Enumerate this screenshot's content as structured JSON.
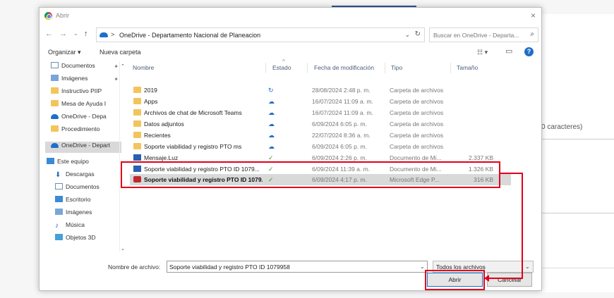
{
  "background": {
    "snippet_text": "0 caracteres)"
  },
  "dialog": {
    "title": "Abrir",
    "close_glyph": "×"
  },
  "address": {
    "back": "←",
    "forward": "→",
    "recent": "⌄",
    "up": "↑",
    "separator": ">",
    "path": "OneDrive - Departamento Nacional de Planeacion",
    "dropdown": "⌄",
    "refresh": "↻",
    "search_placeholder": "Buscar en OneDrive - Departa...",
    "search_icon": "⌕"
  },
  "toolbar": {
    "organize": "Organizar ▾",
    "new_folder": "Nueva carpeta",
    "view_icon": "☷ ▾",
    "pane_icon": "▭",
    "help": "?"
  },
  "sidebar": {
    "items": [
      {
        "label": "Documentos",
        "icon": "doc",
        "pinned": true
      },
      {
        "label": "Imágenes",
        "icon": "img",
        "pinned": true
      },
      {
        "label": "Instructivo PIIP",
        "icon": "folder",
        "pinned": false
      },
      {
        "label": "Mesa de Ayuda I",
        "icon": "folder",
        "pinned": false
      },
      {
        "label": "OneDrive - Depa",
        "icon": "cloud",
        "pinned": false
      },
      {
        "label": "Procedimiento",
        "icon": "folder",
        "pinned": false
      },
      {
        "label": "OneDrive - Depart",
        "icon": "cloud",
        "pinned": false,
        "selected": true
      },
      {
        "label": "Este equipo",
        "icon": "pc",
        "pinned": false
      },
      {
        "label": "Descargas",
        "icon": "down",
        "pinned": false
      },
      {
        "label": "Documentos",
        "icon": "doc",
        "pinned": false
      },
      {
        "label": "Escritorio",
        "icon": "pc",
        "pinned": false
      },
      {
        "label": "Imágenes",
        "icon": "img",
        "pinned": false
      },
      {
        "label": "Música",
        "icon": "music",
        "pinned": false
      },
      {
        "label": "Objetos 3D",
        "icon": "3d",
        "pinned": false
      }
    ],
    "pin_glyph": "✦",
    "scroll_up": "⌃",
    "scroll_down": "⌄"
  },
  "columns": {
    "name": "Nombre",
    "state": "Estado",
    "date": "Fecha de modificación",
    "type": "Tipo",
    "size": "Tamaño",
    "sort_arrow": "^"
  },
  "files": [
    {
      "name": "2019",
      "icon": "folder",
      "state": "sync",
      "state_glyph": "↻",
      "date": "28/08/2024 2:48 p. m.",
      "type": "Carpeta de archivos",
      "size": ""
    },
    {
      "name": "Apps",
      "icon": "folder",
      "state": "cloud",
      "state_glyph": "☁",
      "date": "16/07/2024 11:09 a. m.",
      "type": "Carpeta de archivos",
      "size": ""
    },
    {
      "name": "Archivos de chat de Microsoft Teams",
      "icon": "folder",
      "state": "cloud",
      "state_glyph": "☁",
      "date": "16/07/2024 11:09 a. m.",
      "type": "Carpeta de archivos",
      "size": ""
    },
    {
      "name": "Datos adjuntos",
      "icon": "folder",
      "state": "cloud",
      "state_glyph": "☁",
      "date": "6/09/2024 6:05 p. m.",
      "type": "Carpeta de archivos",
      "size": ""
    },
    {
      "name": "Recientes",
      "icon": "folder",
      "state": "cloud",
      "state_glyph": "☁",
      "date": "22/07/2024 8:36 a. m.",
      "type": "Carpeta de archivos",
      "size": ""
    },
    {
      "name": "Soporte viabilidad y registro PTO ms",
      "icon": "folder",
      "state": "cloud",
      "state_glyph": "☁",
      "date": "6/09/2024 6:05 p. m.",
      "type": "Carpeta de archivos",
      "size": ""
    },
    {
      "name": "Mensaje.Luz",
      "icon": "word",
      "state": "ok",
      "state_glyph": "✓",
      "date": "6/09/2024 2:26 p. m.",
      "type": "Documento de Mi...",
      "size": "2.337 KB"
    },
    {
      "name": "Soporte viabilidad y registro PTO ID 1079...",
      "icon": "word",
      "state": "ok",
      "state_glyph": "✓",
      "date": "6/09/2024 11:39 a. m.",
      "type": "Documento de Mi...",
      "size": "1.326 KB"
    },
    {
      "name": "Soporte viabilidad y registro PTO ID 1079...",
      "icon": "pdf",
      "state": "ok",
      "state_glyph": "✓",
      "date": "6/09/2024 4:17 p. m.",
      "type": "Microsoft Edge P...",
      "size": "316 KB",
      "selected": true
    }
  ],
  "footer": {
    "filename_label": "Nombre de archivo:",
    "filename_value": "Soporte viabilidad y registro PTO ID 1079958",
    "filename_dd": "⌄",
    "filter_value": "Todos los archivos",
    "filter_dd": "⌄",
    "open_label": "Abrir",
    "cancel_label": "Cancelar"
  },
  "colors": {
    "accent": "#0078d7",
    "highlight": "#e2001a",
    "folder": "#f2c55c"
  }
}
